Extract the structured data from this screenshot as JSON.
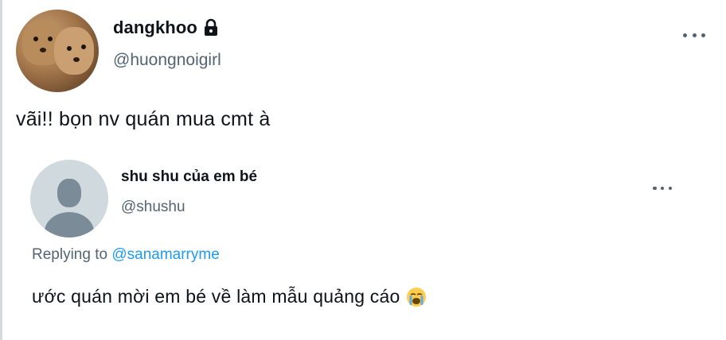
{
  "tweet": {
    "display_name": "dangkhoo",
    "handle": "@huongnoigirl",
    "text": "vãi!! bọn nv quán mua cmt à",
    "icons": [
      "lock-icon",
      "more-options-icon"
    ]
  },
  "quoted_tweet": {
    "display_name": "shu shu của em bé",
    "handle": "@shushu",
    "replying_prefix": "Replying to",
    "replying_mention": "@sanamarryme",
    "text": "ước quán mời em bé về làm mẫu quảng cáo",
    "icons": [
      "default-avatar-icon",
      "more-options-icon",
      "loudly-crying-face-emoji"
    ]
  },
  "colors": {
    "text_primary": "#0f1419",
    "text_secondary": "#536471",
    "link": "#1d9bf0",
    "avatar_placeholder": "#cfd9de"
  }
}
